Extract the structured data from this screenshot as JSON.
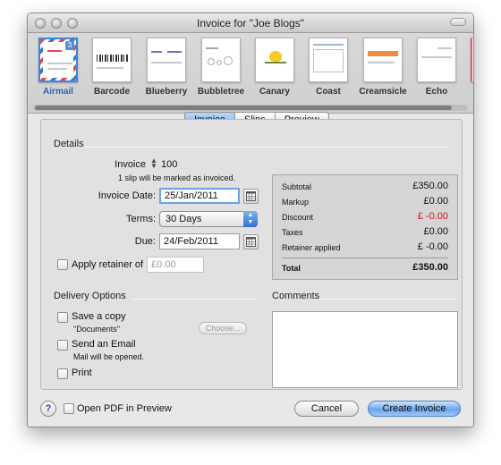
{
  "window": {
    "title": "Invoice for \"Joe  Blogs\""
  },
  "templates": [
    {
      "name": "Airmail",
      "selected": true,
      "badge": "3"
    },
    {
      "name": "Barcode"
    },
    {
      "name": "Blueberry"
    },
    {
      "name": "Bubbletree"
    },
    {
      "name": "Canary"
    },
    {
      "name": "Coast"
    },
    {
      "name": "Creamsicle"
    },
    {
      "name": "Echo"
    }
  ],
  "tabs": [
    {
      "label": "Invoice",
      "active": true
    },
    {
      "label": "Slips"
    },
    {
      "label": "Preview"
    }
  ],
  "details": {
    "heading": "Details",
    "invoice_label": "Invoice",
    "invoice_number": "100",
    "slip_note": "1 slip will be marked as invoiced.",
    "invoice_date_label": "Invoice Date:",
    "invoice_date": "25/Jan/2011",
    "terms_label": "Terms:",
    "terms_value": "30 Days",
    "due_label": "Due:",
    "due_date": "24/Feb/2011",
    "retainer_label": "Apply retainer of",
    "retainer_placeholder": "£0.00"
  },
  "summary": {
    "rows": [
      {
        "label": "Subtotal",
        "value": "£350.00"
      },
      {
        "label": "Markup",
        "value": "£0.00"
      },
      {
        "label": "Discount",
        "value": "£ -0.00",
        "red": true
      },
      {
        "label": "Taxes",
        "value": "£0.00"
      },
      {
        "label": "Retainer applied",
        "value": "£ -0.00"
      }
    ],
    "total_label": "Total",
    "total_value": "£350.00"
  },
  "delivery": {
    "heading": "Delivery Options",
    "save_copy_label": "Save a copy",
    "save_copy_location": "\"Documents\"",
    "choose_label": "Choose...",
    "send_email_label": "Send an Email",
    "send_email_note": "Mail will be opened.",
    "print_label": "Print"
  },
  "comments": {
    "heading": "Comments"
  },
  "footer": {
    "help_label": "?",
    "open_pdf_label": "Open PDF in Preview",
    "cancel_label": "Cancel",
    "create_label": "Create Invoice"
  },
  "colors": {
    "accent": "#3f85d8",
    "discount_red": "#e01010"
  }
}
